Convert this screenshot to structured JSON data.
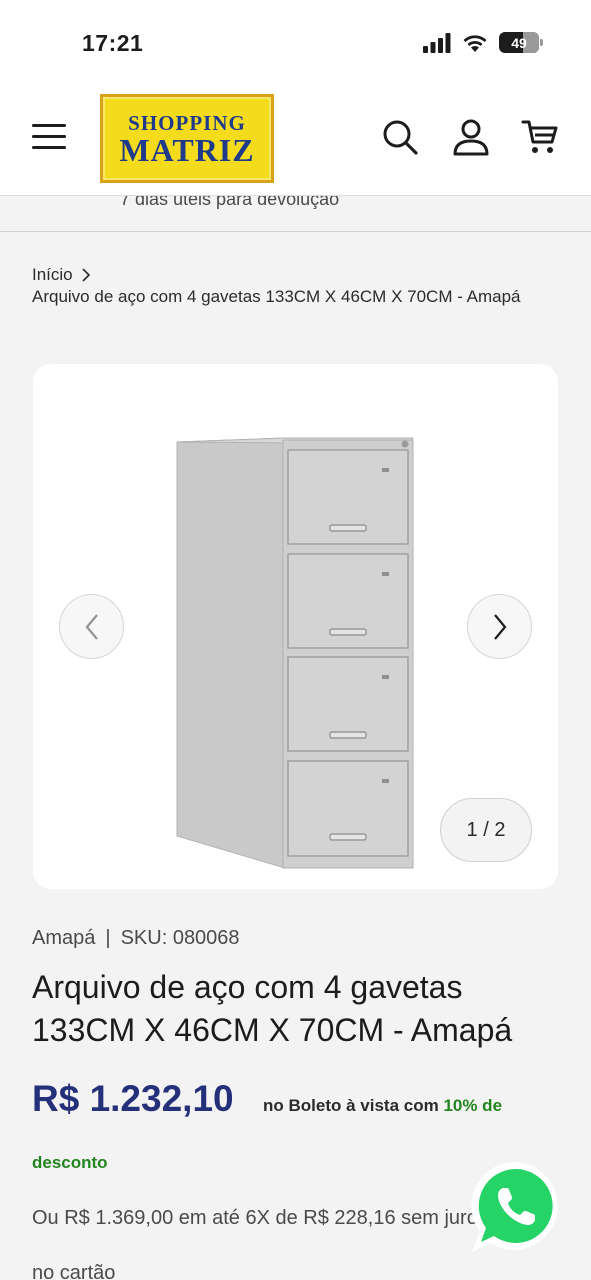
{
  "status_bar": {
    "time": "17:21",
    "battery": "49",
    "icons": [
      "signal-icon",
      "wifi-icon",
      "battery-icon"
    ]
  },
  "header": {
    "logo_line1": "SHOPPING",
    "logo_line2": "MATRIZ",
    "icons": [
      "menu-icon",
      "search-icon",
      "account-icon",
      "cart-icon"
    ]
  },
  "announcement": "7 dias úteis para devolução",
  "breadcrumb": {
    "home": "Início",
    "current": "Arquivo de aço com 4 gavetas 133CM X 46CM X 70CM - Amapá"
  },
  "gallery": {
    "counter": "1 / 2",
    "image_icon": "filing-cabinet-image"
  },
  "product": {
    "vendor": "Amapá",
    "separator": "|",
    "sku": "SKU: 080068",
    "title": "Arquivo de aço com 4 gavetas 133CM X 46CM X 70CM - Amapá",
    "price": "R$ 1.232,10",
    "boleto_text": "no Boleto à vista com",
    "discount_pct": "10% de",
    "discount_word": "desconto",
    "installments": "Ou R$ 1.369,00 em até 6X de R$ 228,16 sem juros",
    "installments_tail": "no cartão"
  },
  "colors": {
    "price": "#25307a",
    "discount": "#23851f",
    "logo_bg": "#f4dc1c",
    "logo_text": "#1f3a8a",
    "whatsapp": "#25d366"
  }
}
